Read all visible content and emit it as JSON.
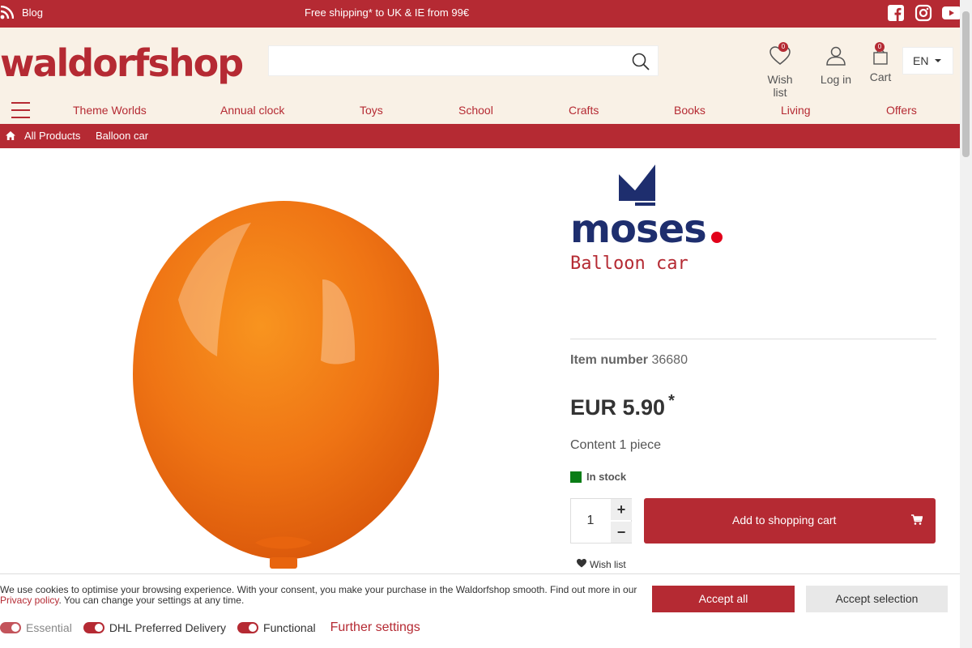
{
  "topbar": {
    "blog_label": "Blog",
    "shipping_text": "Free shipping* to UK & IE from 99€",
    "social": [
      "facebook-icon",
      "instagram-icon",
      "youtube-icon"
    ]
  },
  "header": {
    "logo": "waldorfshop",
    "search_placeholder": "",
    "wishlist_label": "Wish list",
    "wishlist_count": "0",
    "login_label": "Log in",
    "cart_label": "Cart",
    "cart_count": "0",
    "language": "EN"
  },
  "nav": {
    "items": [
      "Theme Worlds",
      "Annual clock",
      "Toys",
      "School",
      "Crafts",
      "Books",
      "Living",
      "Offers"
    ]
  },
  "breadcrumb": {
    "items": [
      "All Products",
      "Balloon car"
    ]
  },
  "product": {
    "brand": "moses",
    "subtitle": "Balloon car",
    "item_number_label": "Item number",
    "item_number": "36680",
    "price": "EUR 5.90",
    "price_mark": "*",
    "content": "Content 1 piece",
    "stock": "In stock",
    "quantity": "1",
    "add_to_cart": "Add to shopping cart",
    "wishlist_link": "Wish list"
  },
  "cookie": {
    "text_before": "We use cookies to optimise your browsing experience. With your consent, you make your purchase in the Waldorfshop smooth. Find out more in our ",
    "privacy_link": "Privacy policy",
    "text_after": ". You can change your settings at any time.",
    "accept_all": "Accept all",
    "accept_selection": "Accept selection",
    "toggles": [
      "Essential",
      "DHL Preferred Delivery",
      "Functional"
    ],
    "further_settings": "Further settings"
  },
  "colors": {
    "brand_red": "#b52a33",
    "header_bg": "#f9f1e6",
    "moses_blue": "#1e2e6e",
    "stock_green": "#0a7d16",
    "balloon_orange": "#f07a1a"
  }
}
